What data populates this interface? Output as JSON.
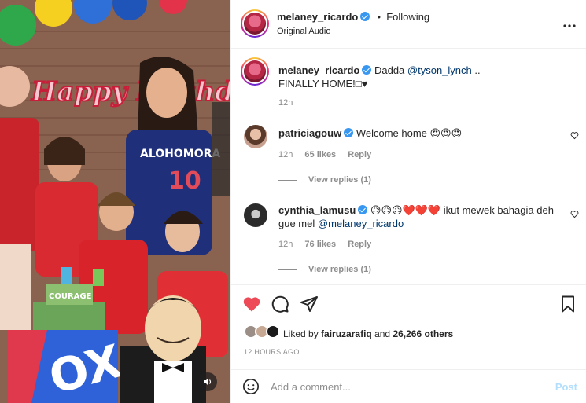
{
  "header": {
    "username": "melaney_ricardo",
    "separator": "•",
    "follow_status": "Following",
    "audio": "Original Audio",
    "more_icon": "more-horizontal-icon"
  },
  "caption": {
    "username": "melaney_ricardo",
    "text_prefix": "Dadda",
    "mention": "@tyson_lynch",
    "text_suffix": "..",
    "line2": "FINALLY HOME!□♥",
    "time": "12h"
  },
  "comments": [
    {
      "username": "patriciagouw",
      "text": "Welcome home 😍😍😍",
      "time": "12h",
      "likes": "65 likes",
      "reply": "Reply",
      "view_replies": "View replies (1)"
    },
    {
      "username": "cynthia_lamusu",
      "text": "😥😥😥❤️❤️❤️ ikut mewek bahagia deh gue mel",
      "mention": "@melaney_ricardo",
      "time": "12h",
      "likes": "76 likes",
      "reply": "Reply",
      "view_replies": "View replies (1)"
    }
  ],
  "actions": {
    "like_icon": "heart-filled-icon",
    "comment_icon": "comment-icon",
    "share_icon": "send-icon",
    "save_icon": "bookmark-icon"
  },
  "likes": {
    "prefix": "Liked by",
    "user": "fairuzarafiq",
    "middle": "and",
    "others": "26,266 others"
  },
  "timestamp": "12 HOURS AGO",
  "composer": {
    "placeholder": "Add a comment...",
    "post_label": "Post"
  },
  "media": {
    "banner_text": "Happy Birthday",
    "cake_label": "COURAGE",
    "shirt_text": "ALOHOMORA",
    "shirt_number": "10"
  },
  "colors": {
    "like_red": "#ed4956",
    "verified_blue": "#3897f0",
    "mention_blue": "#00376b",
    "post_disabled": "#b2dffc",
    "muted": "#8e8e8e"
  }
}
